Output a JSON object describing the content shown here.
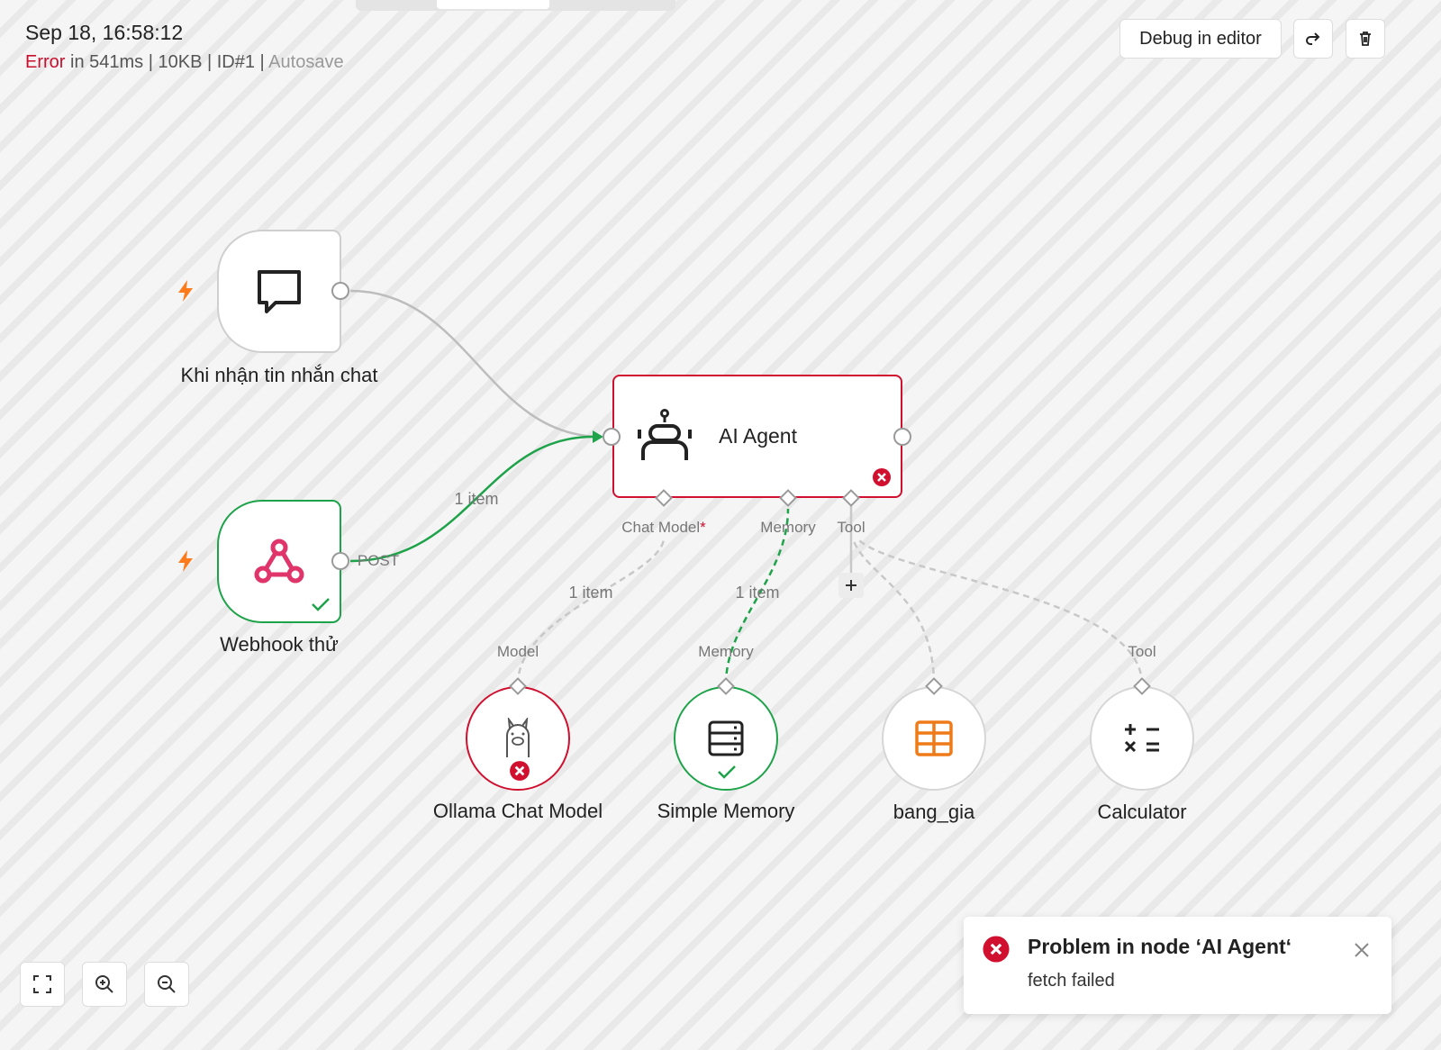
{
  "header": {
    "datetime": "Sep 18, 16:58:12",
    "status": "Error",
    "meta": "in 541ms | 10KB | ID#1 |",
    "autosave": "Autosave"
  },
  "toolbar": {
    "debug_label": "Debug in editor",
    "retry_icon": "redo-icon",
    "delete_icon": "trash-icon"
  },
  "nodes": {
    "chat_trigger": {
      "label": "Khi nhận tin nhắn chat",
      "icon": "chat-bubble-icon"
    },
    "webhook": {
      "label": "Webhook thử",
      "icon": "webhook-icon",
      "output_label": "POST",
      "status": "success"
    },
    "agent": {
      "label": "AI Agent",
      "icon": "robot-icon",
      "status": "error"
    },
    "ollama": {
      "label": "Ollama Chat Model",
      "icon": "llama-icon",
      "status": "error"
    },
    "memory": {
      "label": "Simple Memory",
      "icon": "database-icon",
      "status": "success"
    },
    "bang_gia": {
      "label": "bang_gia",
      "icon": "table-icon"
    },
    "calculator": {
      "label": "Calculator",
      "icon": "calculator-icon"
    }
  },
  "agent_inputs": {
    "chat_model": "Chat Model",
    "required_mark": "*",
    "memory": "Memory",
    "tool": "Tool"
  },
  "sub_ports": {
    "model": "Model",
    "memory": "Memory",
    "tool": "Tool"
  },
  "edges": {
    "webhook_to_agent": "1 item",
    "model_to_agent": "1 item",
    "memory_to_agent": "1 item"
  },
  "toast": {
    "title": "Problem in node ‘AI Agent‘",
    "message": "fetch failed"
  },
  "colors": {
    "error": "#c8102e",
    "success": "#1ea34a",
    "trigger": "#ff7a1a",
    "webhook": "#e0356b",
    "table": "#ef7a18"
  }
}
